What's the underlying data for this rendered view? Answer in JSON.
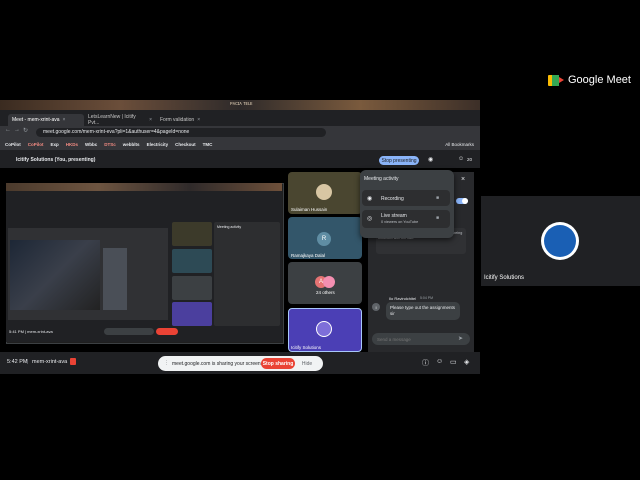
{
  "brand": {
    "name": "Google Meet"
  },
  "side_tile": {
    "name": "Icitify Solutions"
  },
  "wallpaper": {
    "title": "ᴘᴀᴄɪᴀ ᴛᴇʟᴇ"
  },
  "browser": {
    "tabs": [
      {
        "label": "Meet - mem-xrint-ava",
        "active": true
      },
      {
        "label": "LetsLearnNew | Icitify Pvt...",
        "active": false
      },
      {
        "label": "Form validation",
        "active": false
      }
    ],
    "url": "meet.google.com/mem-xrint-eva?pli=1&authuser=4&pageId=none",
    "bookmarks": [
      "CoPilot",
      "CoPilot",
      "Exp",
      "HKDs",
      "Wbbc",
      "DTSc",
      "webblts",
      "Electricity",
      "Checkout",
      "TMC"
    ],
    "bookmark_right": "All Bookmarks"
  },
  "meet_header": {
    "title": "Icitify Solutions (You, presenting)",
    "stop_presenting": "Stop presenting",
    "count": "20"
  },
  "tiles": [
    {
      "name": "Sulaiman Hussain",
      "initial": ""
    },
    {
      "name": "Ramajkaya Dalal",
      "initial": "R"
    },
    {
      "name": "24 others",
      "initial": "A"
    },
    {
      "name": "Icitify Solutions",
      "initial": ""
    }
  ],
  "activity": {
    "title": "Meeting activity",
    "recording": {
      "label": "Recording"
    },
    "live": {
      "label": "Live stream",
      "sub": "0 viewers on YouTube"
    }
  },
  "chat": {
    "info": "visible to people who join later. Messages are being recorded with the call.",
    "sender": "Ilo Ravindchitel",
    "time": "5:04 PM",
    "message": "Please type out the assignments sir",
    "input_placeholder": "Send a message"
  },
  "bottom": {
    "time": "5:42 PM",
    "code": "mem-xrint-ava",
    "share_text": "meet.google.com is sharing your screen.",
    "stop_sharing": "Stop sharing",
    "hide": "Hide"
  },
  "inner": {
    "clock": "5:41 PM | mem-xrint-ava",
    "activity_title": "Meeting activity"
  },
  "icons": {
    "close": "×",
    "send": "➤",
    "chevron": "›"
  }
}
